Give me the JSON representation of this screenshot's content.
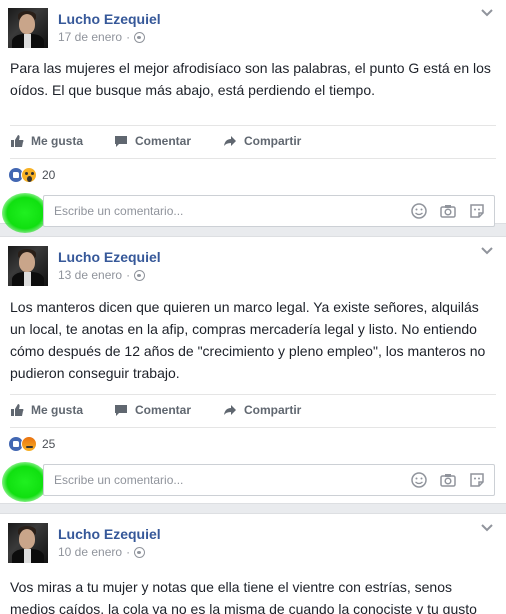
{
  "posts": [
    {
      "author": "Lucho Ezequiel",
      "date": "17 de enero",
      "text": "Para las mujeres el mejor afrodisíaco son las palabras, el punto G está en los oídos. El que busque más abajo, está perdiendo el tiempo.",
      "reactions": [
        "like",
        "wow"
      ],
      "reaction_count": "20"
    },
    {
      "author": "Lucho Ezequiel",
      "date": "13 de enero",
      "text": "Los manteros dicen que quieren un marco legal. Ya existe señores, alquilás un local, te anotas en la afip, compras mercadería legal y listo. No entiendo cómo después de 12 años de \"crecimiento y pleno empleo\", los manteros no pudieron conseguir trabajo.",
      "reactions": [
        "like",
        "angry"
      ],
      "reaction_count": "25"
    },
    {
      "author": "Lucho Ezequiel",
      "date": "10 de enero",
      "text": "Vos miras a tu mujer y notas que ella tiene el vientre con estrías, senos medios caídos, la cola ya no es la misma de cuando la conociste y tu gusto"
    }
  ],
  "actions": {
    "like": "Me gusta",
    "comment": "Comentar",
    "share": "Compartir"
  },
  "comment_placeholder": "Escribe un comentario...",
  "colors": {
    "author": "#365899",
    "like_blue": "#4267b2",
    "feed_bg": "#e9ebee",
    "meta_gray": "#90949c"
  }
}
